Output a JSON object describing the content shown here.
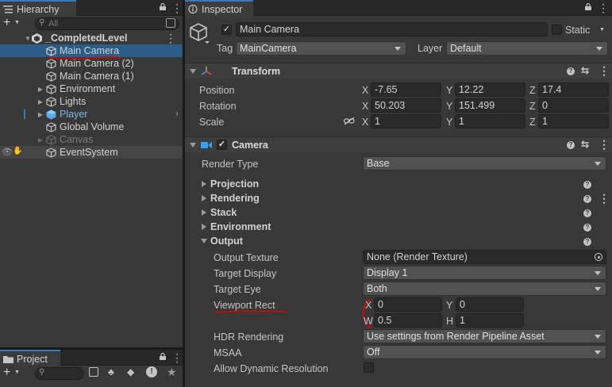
{
  "hierarchy": {
    "tab_label": "Hierarchy",
    "search_placeholder": "All",
    "items": [
      {
        "label": "_CompletedLevel",
        "bold": true
      },
      {
        "label": "Main Camera"
      },
      {
        "label": "Main Camera (2)"
      },
      {
        "label": "Main Camera (1)"
      },
      {
        "label": "Environment"
      },
      {
        "label": "Lights"
      },
      {
        "label": "Player"
      },
      {
        "label": "Global Volume"
      },
      {
        "label": "Canvas"
      },
      {
        "label": "EventSystem"
      }
    ]
  },
  "project": {
    "tab_label": "Project",
    "search_placeholder": ""
  },
  "inspector": {
    "tab_label": "Inspector",
    "object_name": "Main Camera",
    "static_label": "Static",
    "tag_label": "Tag",
    "tag_value": "MainCamera",
    "layer_label": "Layer",
    "layer_value": "Default",
    "transform": {
      "title": "Transform",
      "position_label": "Position",
      "rotation_label": "Rotation",
      "scale_label": "Scale",
      "axis_x": "X",
      "axis_y": "Y",
      "axis_z": "Z",
      "position": {
        "x": "-7.65",
        "y": "12.22",
        "z": "17.4"
      },
      "rotation": {
        "x": "50.203",
        "y": "151.499",
        "z": "0"
      },
      "scale": {
        "x": "1",
        "y": "1",
        "z": "1"
      }
    },
    "camera": {
      "title": "Camera",
      "render_type_label": "Render Type",
      "render_type_value": "Base",
      "sections": [
        "Projection",
        "Rendering",
        "Stack",
        "Environment",
        "Output"
      ],
      "output": {
        "output_texture_label": "Output Texture",
        "output_texture_value": "None (Render Texture)",
        "target_display_label": "Target Display",
        "target_display_value": "Display 1",
        "target_eye_label": "Target Eye",
        "target_eye_value": "Both",
        "viewport_rect_label": "Viewport Rect",
        "axis_x": "X",
        "axis_y": "Y",
        "axis_w": "W",
        "axis_h": "H",
        "viewport": {
          "x": "0",
          "y": "0",
          "w": "0.5",
          "h": "1"
        },
        "hdr_label": "HDR Rendering",
        "hdr_value": "Use settings from Render Pipeline Asset",
        "msaa_label": "MSAA",
        "msaa_value": "Off",
        "dynamic_res_label": "Allow Dynamic Resolution"
      }
    }
  },
  "colors": {
    "selection": "#2c5d87",
    "accent_blue": "#3a79bb",
    "annotation_red": "#e00000"
  }
}
